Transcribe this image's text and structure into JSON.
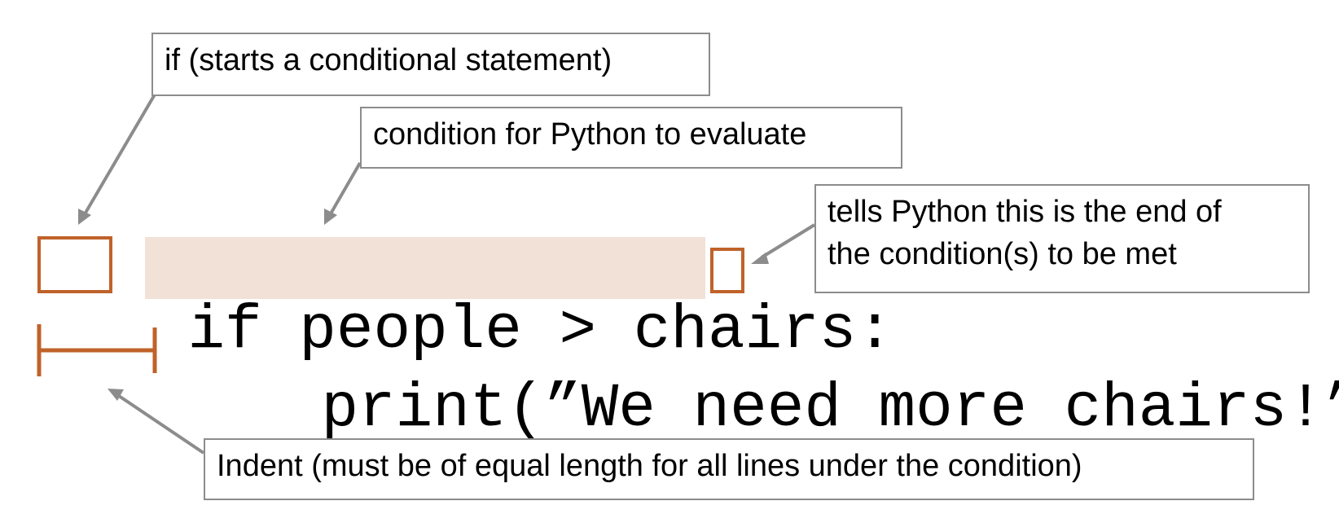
{
  "annotations": {
    "if_label": "if (starts a conditional statement)",
    "condition_label": "condition for Python to evaluate",
    "colon_label_line1": "tells Python this is the end of",
    "colon_label_line2": "the condition(s) to be met",
    "indent_label": "Indent (must be of equal length for all lines under the condition)"
  },
  "code": {
    "keyword": "if",
    "condition": "people > chairs",
    "colon": ":",
    "body": "print(”We need more chairs!”)"
  },
  "colors": {
    "box_border": "#8c8c8c",
    "arrow": "#8c8c8c",
    "accent": "#c0622a",
    "condition_highlight": "#f2e1d6",
    "code_text": "#000000"
  }
}
